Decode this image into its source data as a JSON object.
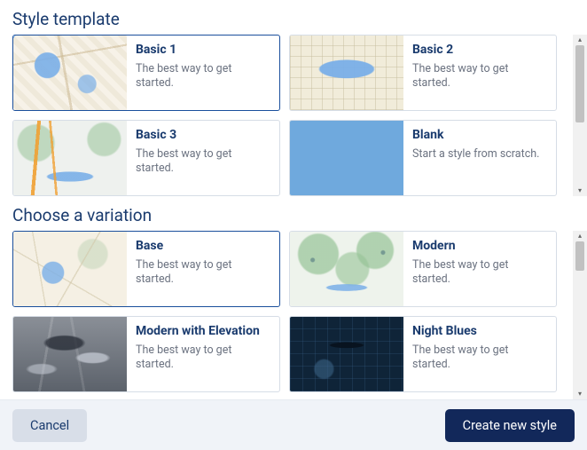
{
  "sections": {
    "templates": {
      "title": "Style template",
      "items": [
        {
          "title": "Basic 1",
          "desc": "The best way to get started.",
          "selected": true,
          "thumb": "thumb-basic1"
        },
        {
          "title": "Basic 2",
          "desc": "The best way to get started.",
          "selected": false,
          "thumb": "thumb-basic2"
        },
        {
          "title": "Basic 3",
          "desc": "The best way to get started.",
          "selected": false,
          "thumb": "thumb-basic3"
        },
        {
          "title": "Blank",
          "desc": "Start a style from scratch.",
          "selected": false,
          "thumb": "thumb-blank"
        }
      ]
    },
    "variations": {
      "title": "Choose a variation",
      "items": [
        {
          "title": "Base",
          "desc": "The best way to get started.",
          "selected": true,
          "thumb": "thumb-base"
        },
        {
          "title": "Modern",
          "desc": "The best way to get started.",
          "selected": false,
          "thumb": "thumb-modern"
        },
        {
          "title": "Modern with Elevation",
          "desc": "The best way to get started.",
          "selected": false,
          "thumb": "thumb-elev"
        },
        {
          "title": "Night Blues",
          "desc": "The best way to get started.",
          "selected": false,
          "thumb": "thumb-night"
        }
      ]
    }
  },
  "footer": {
    "cancel": "Cancel",
    "create": "Create new style"
  }
}
